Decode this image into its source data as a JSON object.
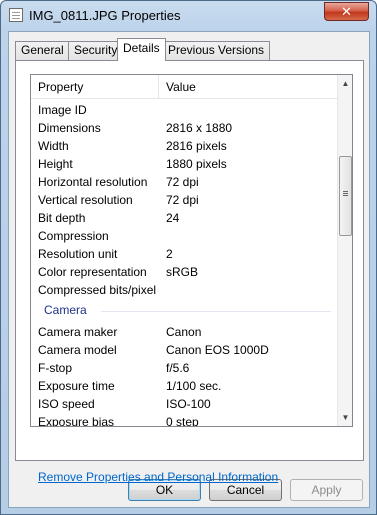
{
  "window": {
    "title": "IMG_0811.JPG Properties",
    "close_symbol": "✕"
  },
  "tabs": [
    {
      "label": "General"
    },
    {
      "label": "Security"
    },
    {
      "label": "Details",
      "selected": true
    },
    {
      "label": "Previous Versions"
    }
  ],
  "details": {
    "columns": {
      "property": "Property",
      "value": "Value"
    },
    "rows": [
      {
        "property": "Image ID",
        "value": ""
      },
      {
        "property": "Dimensions",
        "value": "2816 x 1880"
      },
      {
        "property": "Width",
        "value": "2816 pixels"
      },
      {
        "property": "Height",
        "value": "1880 pixels"
      },
      {
        "property": "Horizontal resolution",
        "value": "72 dpi"
      },
      {
        "property": "Vertical resolution",
        "value": "72 dpi"
      },
      {
        "property": "Bit depth",
        "value": "24"
      },
      {
        "property": "Compression",
        "value": ""
      },
      {
        "property": "Resolution unit",
        "value": "2"
      },
      {
        "property": "Color representation",
        "value": "sRGB"
      },
      {
        "property": "Compressed bits/pixel",
        "value": ""
      }
    ],
    "camera_group": "Camera",
    "camera_rows": [
      {
        "property": "Camera maker",
        "value": "Canon"
      },
      {
        "property": "Camera model",
        "value": "Canon EOS 1000D"
      },
      {
        "property": "F-stop",
        "value": "f/5.6"
      },
      {
        "property": "Exposure time",
        "value": "1/100 sec."
      },
      {
        "property": "ISO speed",
        "value": "ISO-100"
      },
      {
        "property": "Exposure bias",
        "value": "0 step"
      }
    ]
  },
  "remove_link": "Remove Properties and Personal Information",
  "buttons": {
    "ok": "OK",
    "cancel": "Cancel",
    "apply": "Apply"
  },
  "scrollbar": {
    "up_symbol": "▲",
    "down_symbol": "▼",
    "grip_symbol": ""
  },
  "icons": {
    "title": "document-icon",
    "close": "close-icon",
    "scroll_up": "scroll-up-arrow-icon",
    "scroll_down": "scroll-down-arrow-icon"
  },
  "colors": {
    "group_header": "#1e3287",
    "link": "#0066cc",
    "close_button": "#c1361c"
  }
}
